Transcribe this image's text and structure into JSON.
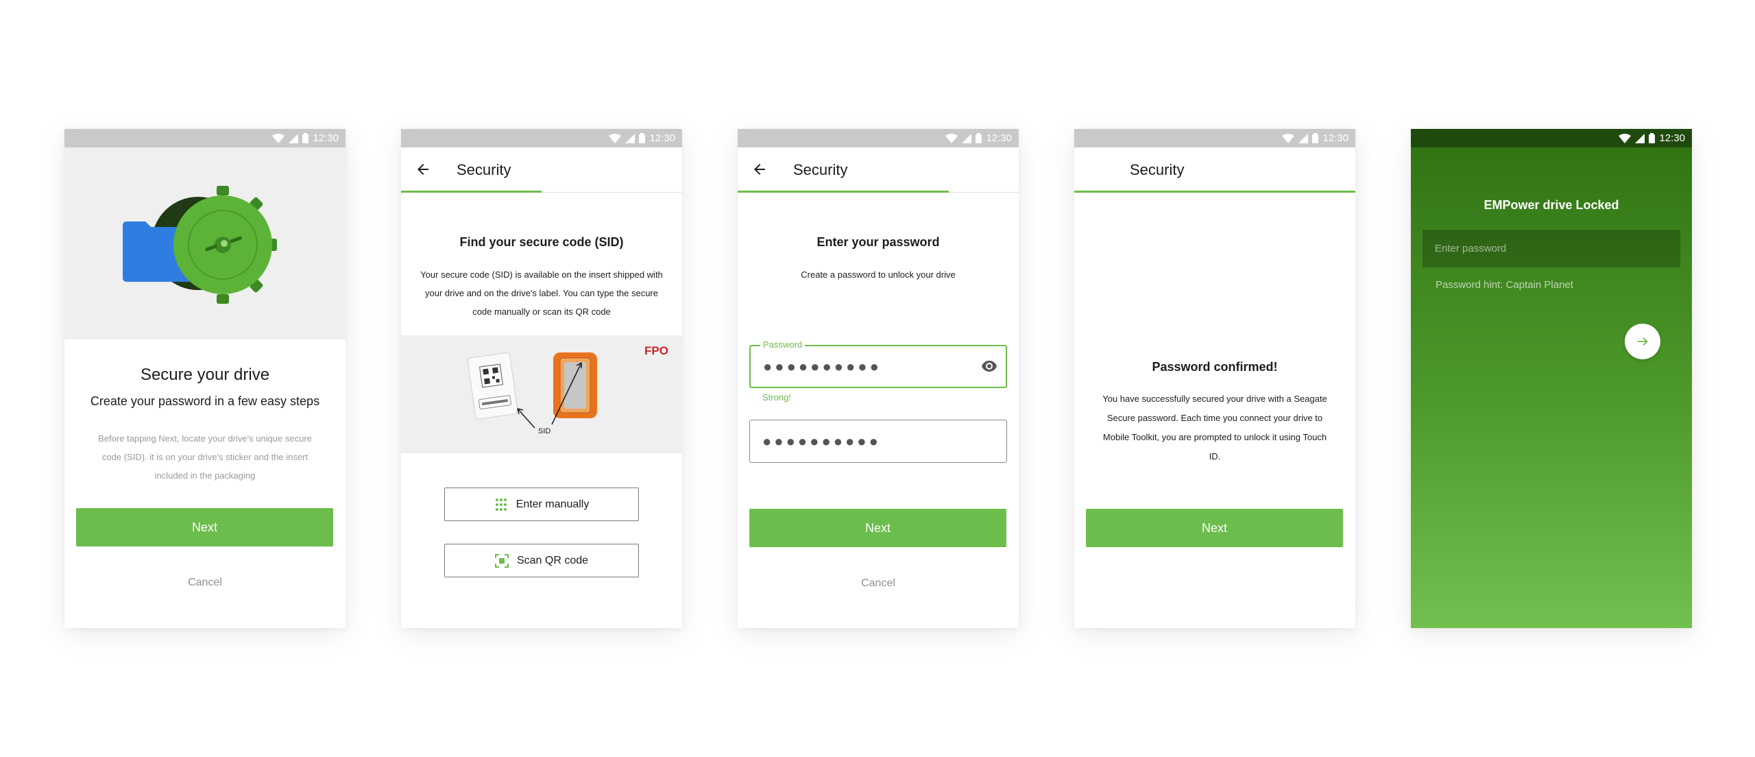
{
  "status": {
    "time": "12:30"
  },
  "colors": {
    "accent": "#6cbd4c",
    "dark_green": "#2f7212",
    "status_gray": "#c9c9c9",
    "fpo_red": "#c9262c"
  },
  "screen1": {
    "title": "Secure your drive",
    "subtitle": "Create your password in a few easy steps",
    "body": "Before tapping Next, locate your drive's unique secure code (SID). it is on your drive's sticker and the insert included in the packaging",
    "next_label": "Next",
    "cancel_label": "Cancel"
  },
  "screen2": {
    "title": "Security",
    "heading": "Find your secure code (SID)",
    "body": "Your secure code (SID) is available on the insert shipped with your drive and on the  drive's label. You can type the secure code  manually or scan its QR code",
    "fpo": "FPO",
    "sid_label": "SID",
    "enter_manually": "Enter manually",
    "scan_qr": "Scan QR code"
  },
  "screen3": {
    "title": "Security",
    "heading": "Enter your password",
    "subtitle": "Create a password to unlock your drive",
    "password_label": "Password",
    "password_value": "●●●●●●●●●●",
    "strength": "Strong!",
    "confirm_value": "●●●●●●●●●●",
    "next_label": "Next",
    "cancel_label": "Cancel"
  },
  "screen4": {
    "title": "Security",
    "heading": "Password confirmed!",
    "body": "You have successfully secured your drive with a Seagate Secure password. Each time you connect your drive to Mobile Toolkit, you are prompted to unlock it using Touch ID.",
    "next_label": "Next"
  },
  "screen5": {
    "title": "EMPower drive Locked",
    "placeholder": "Enter password",
    "hint": "Password hint: Captain Planet"
  }
}
